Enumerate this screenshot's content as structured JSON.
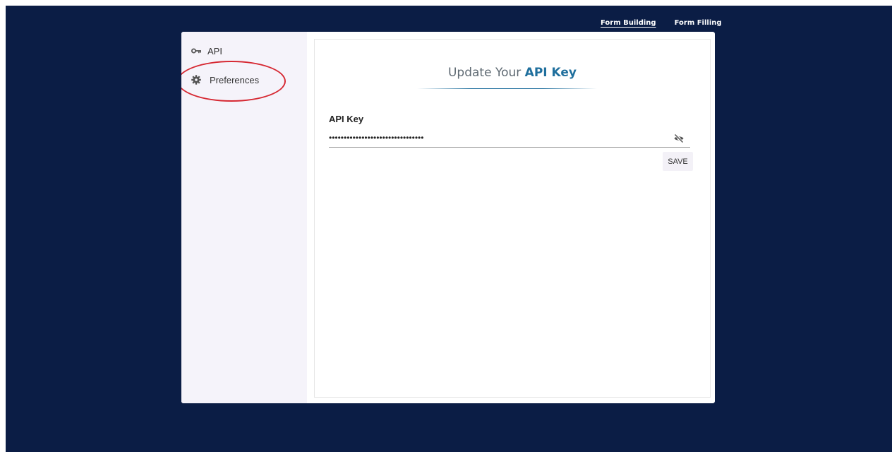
{
  "top_nav": {
    "items": [
      {
        "label": "Form Building",
        "active": true
      },
      {
        "label": "Form Filling",
        "active": false
      }
    ]
  },
  "sidebar": {
    "items": [
      {
        "label": "API",
        "icon": "key-icon"
      },
      {
        "label": "Preferences",
        "icon": "gear-icon"
      }
    ]
  },
  "content": {
    "title_prefix": "Update Your",
    "title_accent": "API Key",
    "field_label": "API Key",
    "api_key_value": "••••••••••••••••••••••••••••••••",
    "save_label": "SAVE"
  },
  "colors": {
    "background": "#0b1d45",
    "sidebar": "#f5f3fa",
    "accent": "#1f6f9d",
    "highlight": "#d62832"
  }
}
